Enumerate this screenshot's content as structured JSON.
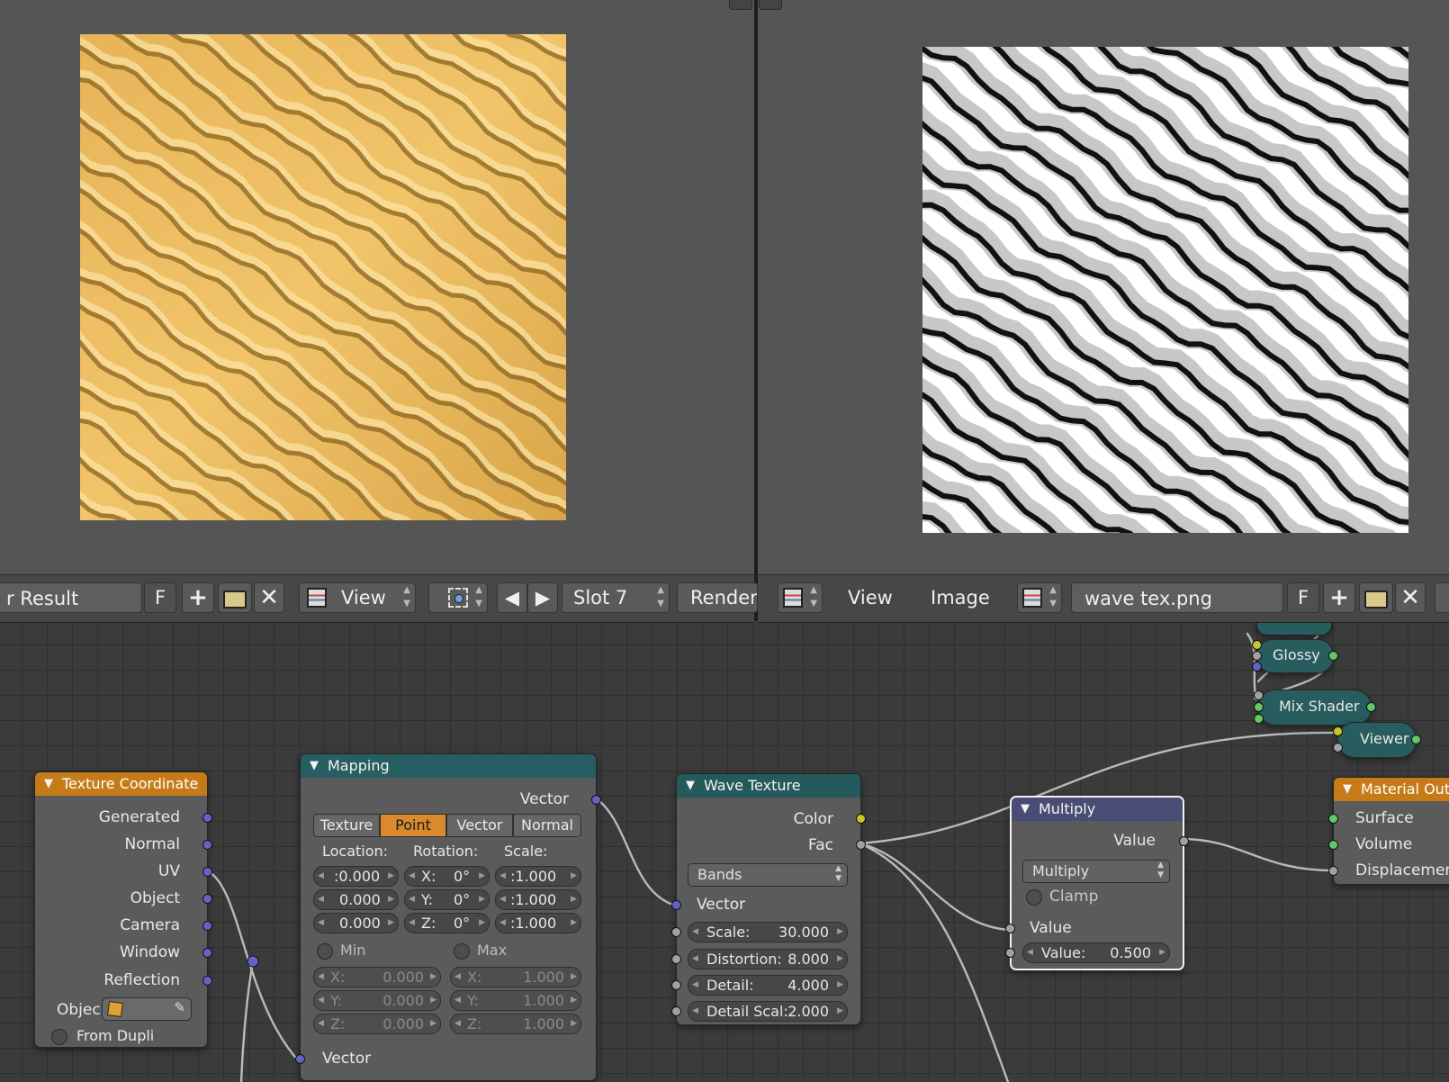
{
  "left_header": {
    "image_name": "r Result",
    "fake_user": "F",
    "view_menu": "View",
    "slot": "Slot 7",
    "render_menu": "Render"
  },
  "right_header": {
    "view_menu": "View",
    "image_menu": "Image",
    "image_name": "wave tex.png",
    "fake_user": "F"
  },
  "nodes": {
    "texture_coordinate": {
      "title": "Texture Coordinate",
      "outputs": [
        "Generated",
        "Normal",
        "UV",
        "Object",
        "Camera",
        "Window",
        "Reflection"
      ],
      "object_label": "Objec",
      "from_dupli": "From Dupli"
    },
    "mapping": {
      "title": "Mapping",
      "output": "Vector",
      "tabs": [
        "Texture",
        "Point",
        "Vector",
        "Normal"
      ],
      "active_tab": "Point",
      "location_label": "Location:",
      "rotation_label": "Rotation:",
      "scale_label": "Scale:",
      "location": [
        ":0.000",
        "0.000",
        "0.000"
      ],
      "rotation": [
        {
          "axis": "X:",
          "value": "0°"
        },
        {
          "axis": "Y:",
          "value": "0°"
        },
        {
          "axis": "Z:",
          "value": "0°"
        }
      ],
      "scale": [
        ":1.000",
        ":1.000",
        ":1.000"
      ],
      "min_label": "Min",
      "max_label": "Max",
      "min": [
        {
          "axis": "X:",
          "value": "0.000"
        },
        {
          "axis": "Y:",
          "value": "0.000"
        },
        {
          "axis": "Z:",
          "value": "0.000"
        }
      ],
      "max": [
        {
          "axis": "X:",
          "value": "1.000"
        },
        {
          "axis": "Y:",
          "value": "1.000"
        },
        {
          "axis": "Z:",
          "value": "1.000"
        }
      ],
      "input": "Vector"
    },
    "wave_texture": {
      "title": "Wave Texture",
      "out_color": "Color",
      "out_fac": "Fac",
      "wave_type": "Bands",
      "in_vector": "Vector",
      "scale_label": "Scale:",
      "scale_value": "30.000",
      "distortion_label": "Distortion:",
      "distortion_value": "8.000",
      "detail_label": "Detail:",
      "detail_value": "4.000",
      "detail_scale_label": "Detail Scal:",
      "detail_scale_value": "2.000"
    },
    "multiply": {
      "title": "Multiply",
      "output": "Value",
      "operation": "Multiply",
      "clamp": "Clamp",
      "input_value": "Value",
      "value_label": "Value:",
      "value": "0.500"
    },
    "glossy": {
      "title": "Glossy"
    },
    "mix_shader": {
      "title": "Mix Shader"
    },
    "viewer": {
      "title": "Viewer"
    },
    "material_output": {
      "title": "Material Outp",
      "inputs": [
        "Surface",
        "Volume",
        "Displacement"
      ]
    }
  },
  "colors": {
    "node_header_input": "#c57b18",
    "node_header_texture": "#245a5c",
    "node_header_converter": "#494c75",
    "socket_vector": "#6363c7",
    "socket_float": "#a1a1a1",
    "socket_color": "#c7c729",
    "socket_shader": "#63c763",
    "active_button": "#d98a2c"
  }
}
